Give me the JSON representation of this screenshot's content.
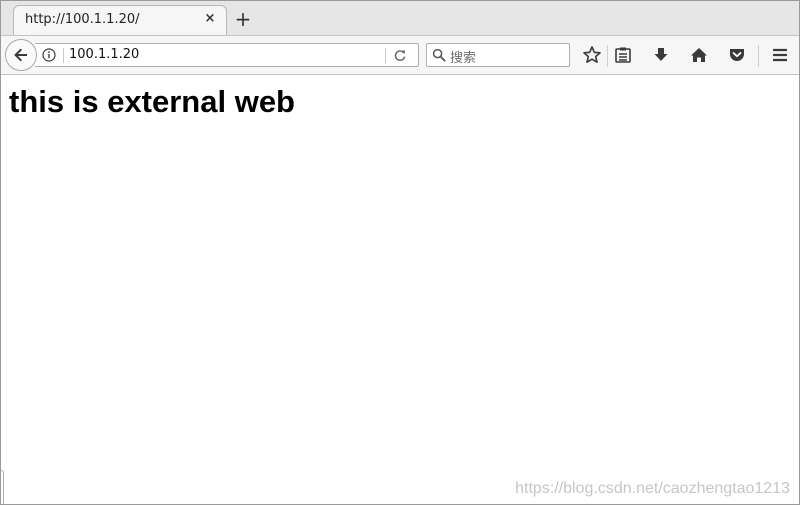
{
  "tab": {
    "title": "http://100.1.1.20/",
    "close_glyph": "×",
    "new_tab_glyph": "+"
  },
  "navbar": {
    "url": "100.1.1.20",
    "search_placeholder": "搜索",
    "icons": [
      "back-arrow-icon",
      "info-icon",
      "reload-icon",
      "search-icon",
      "bookmark-star-icon",
      "reading-list-icon",
      "download-icon",
      "home-icon",
      "pocket-icon",
      "menu-icon"
    ]
  },
  "page": {
    "heading": "this is external web"
  },
  "watermark": "https://blog.csdn.net/caozhengtao1213",
  "colors": {
    "toolbar_bg": "#f6f6f6",
    "tabstrip_bg": "#e6e6e6",
    "icon": "#3a3a3a"
  }
}
